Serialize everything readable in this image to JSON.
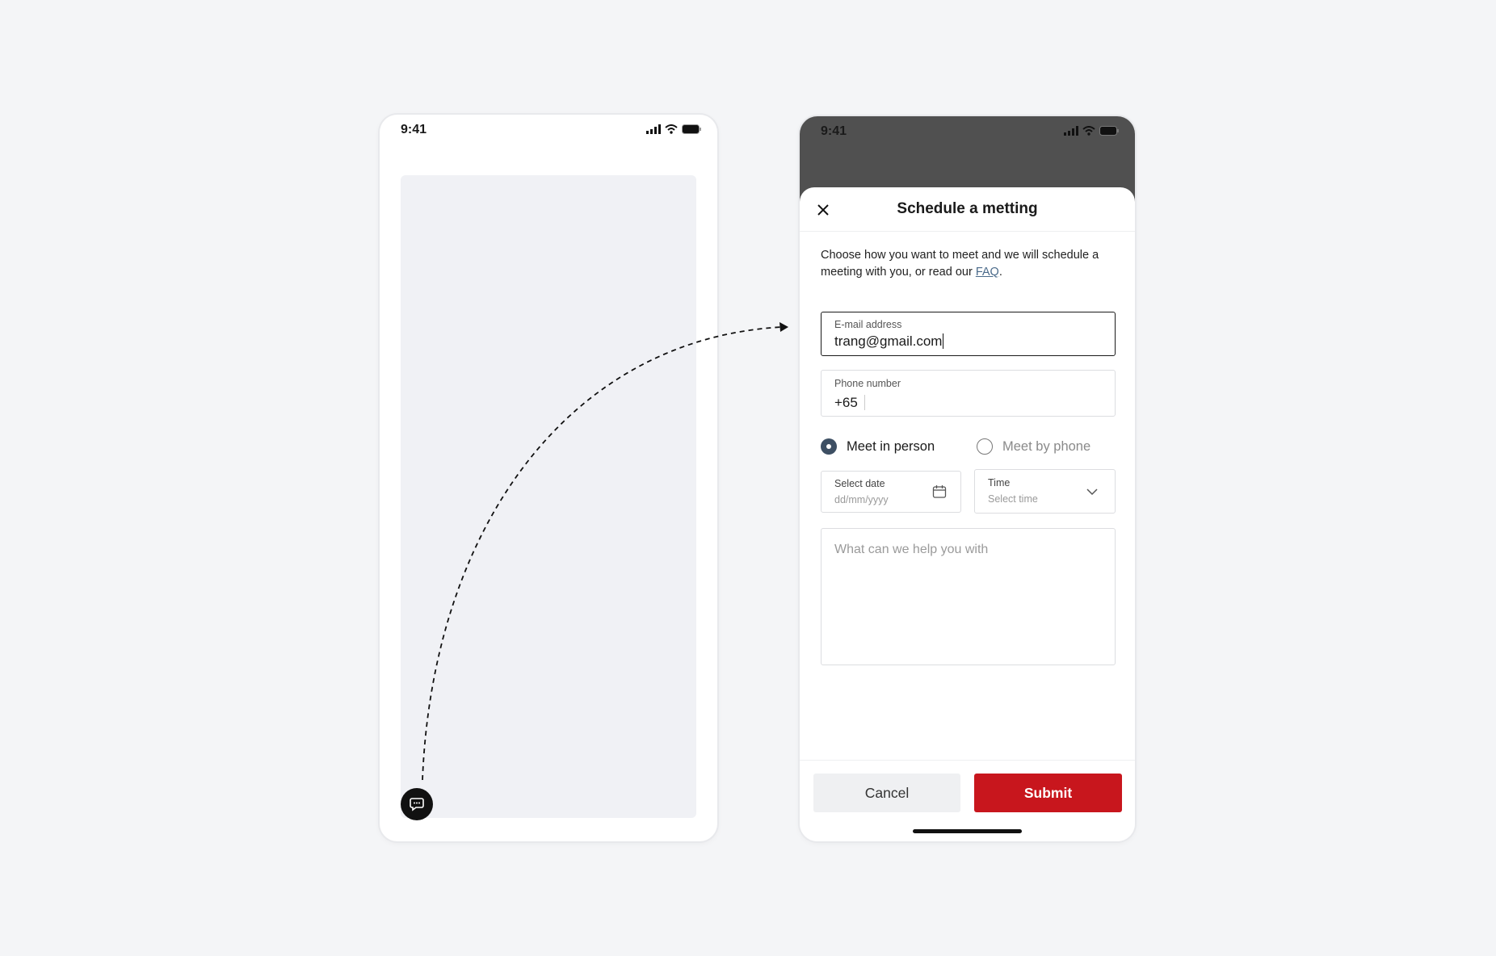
{
  "status_bar": {
    "time": "9:41"
  },
  "sheet": {
    "title": "Schedule a metting",
    "description": "Choose how you want to meet and we will schedule a meeting with you, or read our ",
    "faq_link": "FAQ",
    "description_end": "."
  },
  "form": {
    "email": {
      "label": "E-mail address",
      "value": "trang@gmail.com"
    },
    "phone": {
      "label": "Phone number",
      "prefix": "+65",
      "value": ""
    },
    "meeting_type": {
      "options": [
        {
          "label": "Meet in person",
          "selected": true
        },
        {
          "label": "Meet by phone",
          "selected": false
        }
      ]
    },
    "date": {
      "label": "Select date",
      "placeholder": "dd/mm/yyyy"
    },
    "time": {
      "label": "Time",
      "placeholder": "Select time"
    },
    "message": {
      "placeholder": "What can we help you with"
    }
  },
  "footer": {
    "cancel_label": "Cancel",
    "submit_label": "Submit"
  },
  "colors": {
    "accent": "#c8161d",
    "radio": "#3d4f63",
    "link": "#4a6a8a",
    "overlay": "#505050",
    "placeholder_bg": "#f0f1f5"
  },
  "icons": [
    "signal-icon",
    "wifi-icon",
    "battery-icon",
    "close-icon",
    "calendar-icon",
    "chevron-down-icon",
    "chat-icon"
  ]
}
